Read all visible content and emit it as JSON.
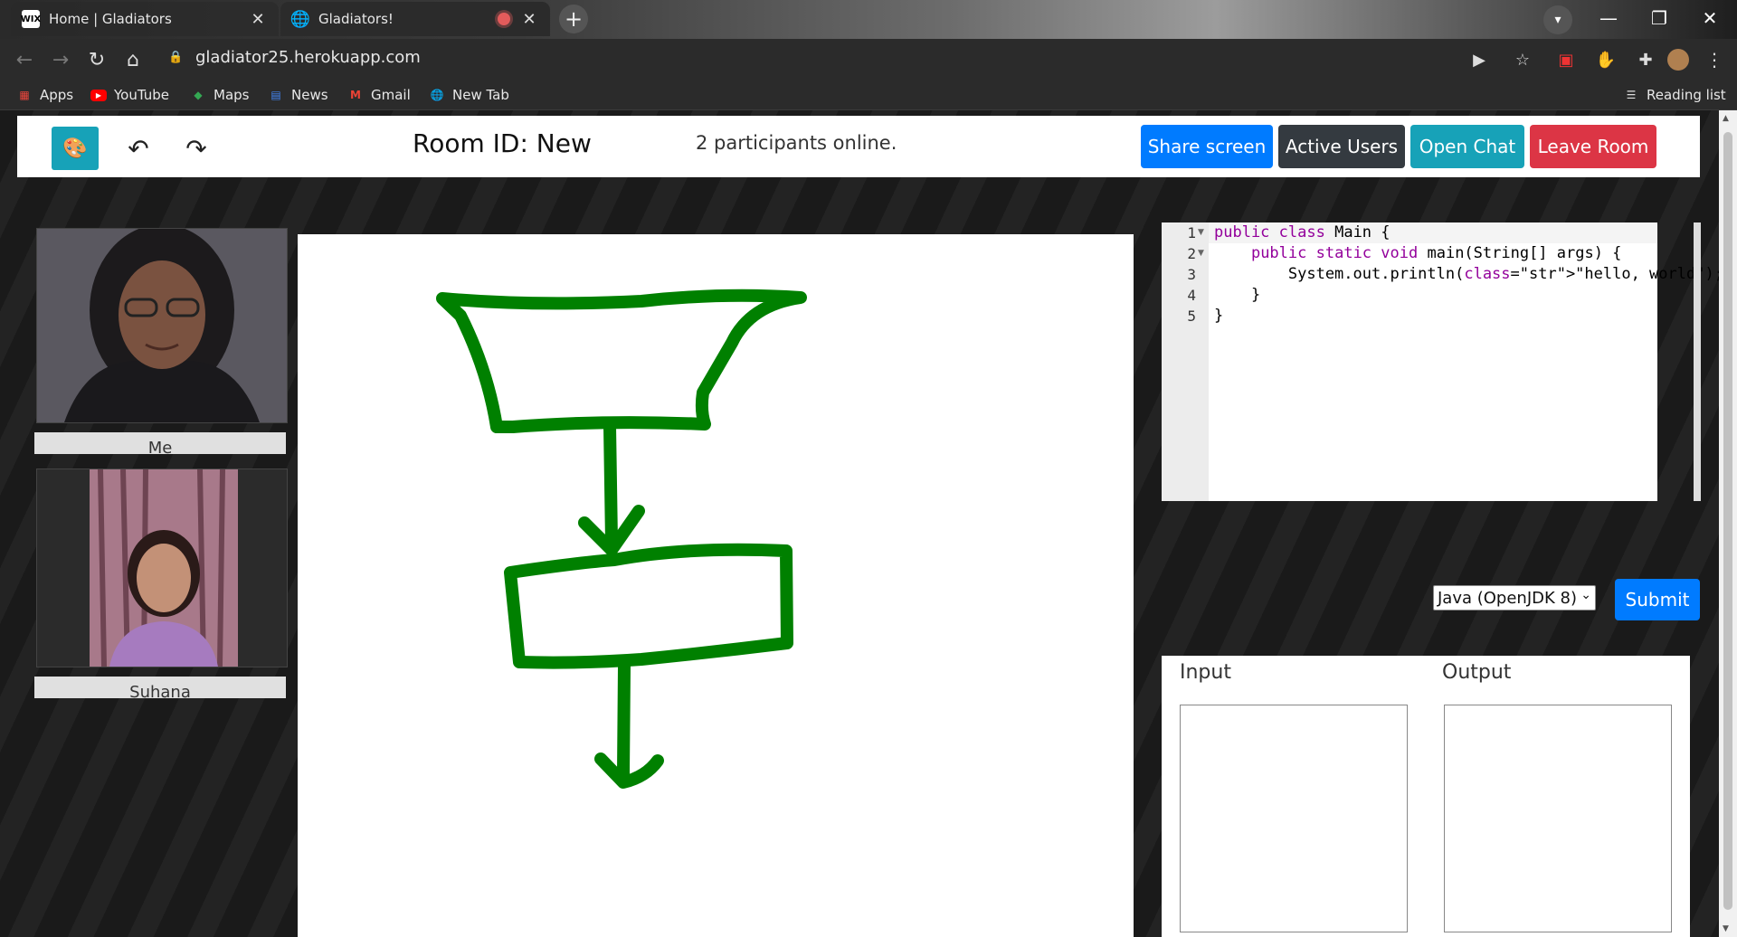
{
  "browser": {
    "tabs": [
      {
        "title": "Home | Gladiators",
        "favicon": "wix-icon",
        "favicon_text": "WIX"
      },
      {
        "title": "Gladiators!",
        "favicon": "globe-icon"
      }
    ],
    "url": "gladiator25.herokuapp.com",
    "bookmarks": [
      {
        "label": "Apps",
        "icon": "apps-grid-icon"
      },
      {
        "label": "YouTube",
        "icon": "youtube-icon"
      },
      {
        "label": "Maps",
        "icon": "maps-icon"
      },
      {
        "label": "News",
        "icon": "news-icon"
      },
      {
        "label": "Gmail",
        "icon": "gmail-icon"
      },
      {
        "label": "New Tab",
        "icon": "globe-icon"
      }
    ],
    "reading_list": "Reading list"
  },
  "header": {
    "room_id": "Room ID: New",
    "participants": "2 participants online.",
    "buttons": {
      "share": "Share screen",
      "users": "Active Users",
      "chat": "Open Chat",
      "leave": "Leave Room"
    }
  },
  "videos": [
    {
      "label": "Me"
    },
    {
      "label": "Suhana"
    }
  ],
  "whiteboard": {
    "stroke_color": "#008000",
    "drawing": "flowchart"
  },
  "editor": {
    "line_numbers": [
      "1",
      "2",
      "3",
      "4",
      "5"
    ],
    "code": [
      "public class Main {",
      "    public static void main(String[] args) {",
      "        System.out.println(\"hello, world\");",
      "    }",
      "}"
    ]
  },
  "language_select": "Java (OpenJDK 8)",
  "submit_label": "Submit",
  "io": {
    "input_label": "Input",
    "output_label": "Output"
  },
  "colors": {
    "primary": "#007bff",
    "info": "#17a2b8",
    "dark": "#343a40",
    "danger": "#dc3545"
  }
}
